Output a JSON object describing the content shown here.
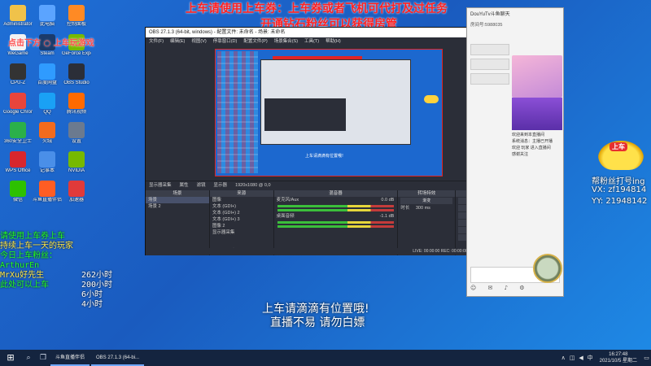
{
  "desktop": {
    "icons": [
      {
        "label": "Administrator",
        "color": "#f0c24a"
      },
      {
        "label": "此电脑",
        "color": "#5ba4ff"
      },
      {
        "label": "控制面板",
        "color": "#ff8a24"
      },
      {
        "label": "WeGame",
        "color": "#f2f2f2"
      },
      {
        "label": "Steam",
        "color": "#1b3b6b"
      },
      {
        "label": "GeForce Experience",
        "color": "#76b900"
      },
      {
        "label": "CPU-Z",
        "color": "#333333"
      },
      {
        "label": "百度网盘",
        "color": "#2f9bff"
      },
      {
        "label": "OBS Studio",
        "color": "#2b2e38"
      },
      {
        "label": "Google Chrome",
        "color": "#e8453c"
      },
      {
        "label": "QQ",
        "color": "#1aa1f5"
      },
      {
        "label": "腾讯视频",
        "color": "#ff6a00"
      },
      {
        "label": "360安全卫士",
        "color": "#2bb04a"
      },
      {
        "label": "火绒",
        "color": "#f26b1d"
      },
      {
        "label": "设置",
        "color": "#6b7a8f"
      },
      {
        "label": "WPS Office",
        "color": "#d8262d"
      },
      {
        "label": "记事本",
        "color": "#4a8fe8"
      },
      {
        "label": "NVIDIA",
        "color": "#76b900"
      },
      {
        "label": "微信",
        "color": "#2dc100"
      },
      {
        "label": "斗鱼直播伴侣",
        "color": "#ff5d23"
      },
      {
        "label": "加速器",
        "color": "#e03a3a"
      }
    ]
  },
  "overlay": {
    "banner_line1": "上车请使用上车券：上车券或者飞机可代打及过任务",
    "banner_line2": "开通钻石粉丝可以获得房管",
    "top_small": "点击下方 ○ 上车玩游戏",
    "left_lines": [
      {
        "text": "请使用上车券上车",
        "color": "green"
      },
      {
        "text": "持续上车一天的玩家",
        "color": "yellow"
      },
      {
        "text": "今日上车粉丝：",
        "color": "green"
      },
      {
        "text": "ArthurEn",
        "color": "green"
      },
      {
        "text": "MrXu好先生",
        "color": "yellow"
      },
      {
        "text": "此处可以上车",
        "color": "green"
      }
    ],
    "hours_lines": [
      "262小时",
      "200小时",
      "6小时",
      "4小时"
    ],
    "bottom_line1": "上车请滴滴有位置哦!",
    "bottom_line2": "直播不易 请勿白嫖"
  },
  "obs": {
    "title": "OBS 27.1.3 (64-bit, windows) - 配置文件: 未命名 - 场景: 未命名",
    "menu": [
      "文件(F)",
      "编辑(E)",
      "视图(V)",
      "停靠窗口(D)",
      "配置文件(P)",
      "场景集合(S)",
      "工具(T)",
      "帮助(H)"
    ],
    "source_bar": [
      "显示器采集",
      "属性",
      "滤镜",
      "显示器",
      "1920x1080 @ 0,0"
    ],
    "preview_text": "上车请滴滴有位置哦!",
    "docks": {
      "scenes": {
        "title": "场景",
        "items": [
          "场景",
          "场景 2"
        ]
      },
      "sources": {
        "title": "来源",
        "items": [
          "图像",
          "文本 (GDI+)",
          "文本 (GDI+) 2",
          "文本 (GDI+) 3",
          "图像 2",
          "显示器采集"
        ]
      },
      "mixer": {
        "title": "混音器",
        "channels": [
          {
            "name": "麦克风/Aux",
            "db": "0.0 dB"
          },
          {
            "name": "桌面音频",
            "db": "-1.1 dB"
          }
        ]
      },
      "transitions": {
        "title": "转场特效",
        "type": "渐变",
        "duration_label": "时长",
        "duration": "300 ms"
      },
      "controls": {
        "title": "控件",
        "buttons": [
          "停止推流",
          "开始录制",
          "启动虚拟摄像机",
          "工作室模式",
          "设置",
          "退出"
        ]
      }
    },
    "status": "LIVE: 00:00:00   REC: 00:00:00   CPU: 1.2%, 60.00 fps"
  },
  "chat": {
    "title": "DouYuTv斗鱼聊天",
    "room_id": "房间号:5988035",
    "messages": [
      "欢迎来到本直播间",
      "系统消息：主播已开播",
      "欢迎 玩家 进入直播间",
      "感谢关注"
    ]
  },
  "fan_info": {
    "line1": "帮粉丝打号ing",
    "line2": "VX:  zf194814",
    "line3": "YY:  21948142",
    "car_label": "上车"
  },
  "taskbar": {
    "start": "⊞",
    "apps": [
      "斗鱼直播伴侣",
      "OBS 27.1.3 (64-bi..."
    ],
    "time": "16:27:48",
    "date": "2021/10/5 星期二",
    "ime": "中",
    "accent": "#6fa8ff"
  }
}
